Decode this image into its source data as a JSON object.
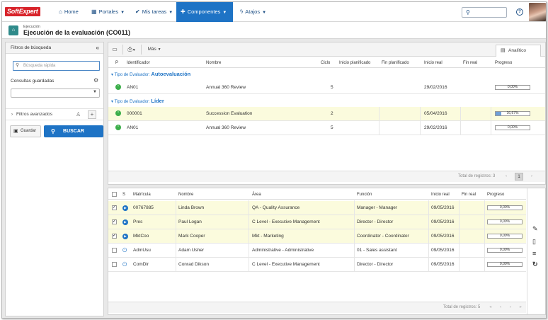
{
  "brand": {
    "logo_text": "SoftExpert",
    "accent": "#1e73c5",
    "logo_color": "#d8232a"
  },
  "nav": {
    "items": [
      {
        "icon": "home-icon",
        "label": "Home"
      },
      {
        "icon": "grid-icon",
        "label": "Portales"
      },
      {
        "icon": "check-icon",
        "label": "Mis tareas"
      },
      {
        "icon": "puzzle-icon",
        "label": "Componentes"
      },
      {
        "icon": "bolt-icon",
        "label": "Atajos"
      }
    ],
    "active": "Componentes"
  },
  "page": {
    "subtitle": "Ejecución",
    "title": "Ejecución de la evaluación (CO011)"
  },
  "sidebar": {
    "title": "Filtros de búsqueda",
    "quick_search_placeholder": "Búsqueda rápida",
    "saved_queries_label": "Consultas guardadas",
    "advanced_filters_label": "Filtros avanzados",
    "save_label": "Guardar",
    "search_label": "BUSCAR"
  },
  "toolbar": {
    "more_label": "Más",
    "analytic_tab": "Analítico"
  },
  "upper_table": {
    "columns": [
      "P",
      "Identificador",
      "Nombre",
      "Ciclo",
      "Inicio planificado",
      "Fin planificado",
      "Inicio real",
      "Fin real",
      "Progreso"
    ],
    "groups": [
      {
        "label": "Tipo de Evaluador:",
        "value": "Autoevaluación",
        "rows": [
          {
            "id": "AN01",
            "name": "Annual 360 Review",
            "cycle": "5",
            "start_planned": "",
            "end_planned": "",
            "start_real": "29/02/2016",
            "end_real": "",
            "progress": "0,00%",
            "progress_value": 0,
            "highlight": false
          }
        ]
      },
      {
        "label": "Tipo de Evaluador:",
        "value": "Líder",
        "rows": [
          {
            "id": "000001",
            "name": "Succession Evaluation",
            "cycle": "2",
            "start_planned": "",
            "end_planned": "",
            "start_real": "05/04/2016",
            "end_real": "",
            "progress": "16,67%",
            "progress_value": 16.67,
            "highlight": true
          },
          {
            "id": "AN01",
            "name": "Annual 360 Review",
            "cycle": "5",
            "start_planned": "",
            "end_planned": "",
            "start_real": "29/02/2016",
            "end_real": "",
            "progress": "0,00%",
            "progress_value": 0,
            "highlight": false
          }
        ]
      }
    ],
    "total_label": "Total de registros: 3",
    "current_page": "1"
  },
  "lower_table": {
    "columns": [
      "S",
      "Matrícula",
      "Nombre",
      "Área",
      "Función",
      "Inicio real",
      "Fin real",
      "Progreso"
    ],
    "rows": [
      {
        "checked": true,
        "status": "play",
        "matricula": "00767885",
        "name": "Linda Brown",
        "area": "QA - Quality Assurance",
        "function": "Manager - Manager",
        "start_real": "09/05/2016",
        "end_real": "",
        "progress": "0,00%",
        "highlight": true
      },
      {
        "checked": true,
        "status": "play",
        "matricula": "Pres",
        "name": "Paul Logan",
        "area": "C Level - Executive Management",
        "function": "Director - Director",
        "start_real": "09/05/2016",
        "end_real": "",
        "progress": "0,00%",
        "highlight": true
      },
      {
        "checked": true,
        "status": "play",
        "matricula": "MktCoo",
        "name": "Mark Cooper",
        "area": "Mkt - Marketing",
        "function": "Coordinator - Coordinator",
        "start_real": "09/05/2016",
        "end_real": "",
        "progress": "0,00%",
        "highlight": true
      },
      {
        "checked": false,
        "status": "power",
        "matricula": "AdmUsu",
        "name": "Adam Usher",
        "area": "Administrative - Administrative",
        "function": "01 - Sales assistant",
        "start_real": "09/05/2016",
        "end_real": "",
        "progress": "0,00%",
        "highlight": false
      },
      {
        "checked": false,
        "status": "power",
        "matricula": "ComDir",
        "name": "Conrad Dikson",
        "area": "C Level - Executive Management",
        "function": "Director - Director",
        "start_real": "09/05/2016",
        "end_real": "",
        "progress": "0,00%",
        "highlight": false
      }
    ],
    "total_label": "Total de registros: 5"
  },
  "side_tools": [
    "pencil-icon",
    "document-icon",
    "list-icon",
    "refresh-icon"
  ]
}
